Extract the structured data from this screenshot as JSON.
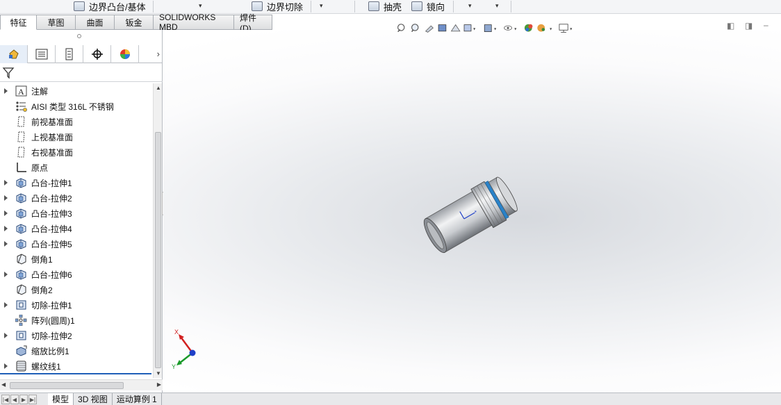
{
  "ribbon": {
    "boundary_boss": "边界凸台/基体",
    "boundary_cut": "边界切除",
    "shell": "抽壳",
    "mirror": "镜向"
  },
  "tabs": [
    {
      "label": "特征",
      "active": true
    },
    {
      "label": "草图"
    },
    {
      "label": "曲面"
    },
    {
      "label": "钣金"
    },
    {
      "label": "SOLIDWORKS MBD"
    },
    {
      "label": "焊件(D)"
    }
  ],
  "tree": {
    "items": [
      {
        "label": "注解",
        "icon": "annotation-icon",
        "expandable": true
      },
      {
        "label": "AISI 类型 316L 不锈钢",
        "icon": "material-icon",
        "expandable": false
      },
      {
        "label": "前视基准面",
        "icon": "plane-icon",
        "expandable": false
      },
      {
        "label": "上视基准面",
        "icon": "plane-icon",
        "expandable": false
      },
      {
        "label": "右视基准面",
        "icon": "plane-icon",
        "expandable": false
      },
      {
        "label": "原点",
        "icon": "origin-icon",
        "expandable": false
      },
      {
        "label": "凸台-拉伸1",
        "icon": "extrude-icon",
        "expandable": true
      },
      {
        "label": "凸台-拉伸2",
        "icon": "extrude-icon",
        "expandable": true
      },
      {
        "label": "凸台-拉伸3",
        "icon": "extrude-icon",
        "expandable": true
      },
      {
        "label": "凸台-拉伸4",
        "icon": "extrude-icon",
        "expandable": true
      },
      {
        "label": "凸台-拉伸5",
        "icon": "extrude-icon",
        "expandable": true
      },
      {
        "label": "倒角1",
        "icon": "chamfer-icon",
        "expandable": false
      },
      {
        "label": "凸台-拉伸6",
        "icon": "extrude-icon",
        "expandable": true
      },
      {
        "label": "倒角2",
        "icon": "chamfer-icon",
        "expandable": false
      },
      {
        "label": "切除-拉伸1",
        "icon": "cut-extrude-icon",
        "expandable": true
      },
      {
        "label": "阵列(圆周)1",
        "icon": "circular-pattern-icon",
        "expandable": false
      },
      {
        "label": "切除-拉伸2",
        "icon": "cut-extrude-icon",
        "expandable": true
      },
      {
        "label": "缩放比例1",
        "icon": "scale-icon",
        "expandable": false
      },
      {
        "label": "螺纹线1",
        "icon": "thread-icon",
        "expandable": true
      }
    ]
  },
  "triad": {
    "x_label": "X",
    "y_label": "Y"
  },
  "bottom_tabs": [
    {
      "label": "模型",
      "active": true
    },
    {
      "label": "3D 视图"
    },
    {
      "label": "运动算例 1"
    }
  ],
  "colors": {
    "accent": "#1f5fb8",
    "triad_x": "#d22020",
    "triad_y": "#1a9a2a",
    "triad_z": "#1f3fc8"
  }
}
